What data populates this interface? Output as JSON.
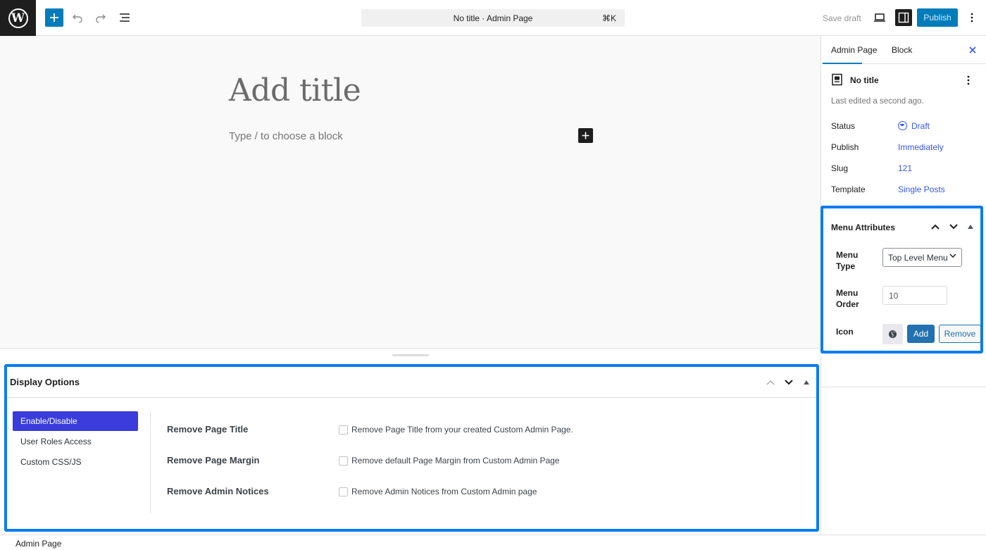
{
  "topbar": {
    "logo_letter": "W",
    "command_title": "No title · Admin Page",
    "command_shortcut": "⌘K",
    "save_draft": "Save draft",
    "publish": "Publish"
  },
  "editor": {
    "title_placeholder": "Add title",
    "block_placeholder": "Type / to choose a block"
  },
  "display_options": {
    "title": "Display Options",
    "tabs": [
      {
        "label": "Enable/Disable",
        "active": true
      },
      {
        "label": "User Roles Access",
        "active": false
      },
      {
        "label": "Custom CSS/JS",
        "active": false
      }
    ],
    "options": [
      {
        "label": "Remove Page Title",
        "description": "Remove Page Title from your created Custom Admin Page.",
        "checked": false
      },
      {
        "label": "Remove Page Margin",
        "description": "Remove default Page Margin from Custom Admin Page",
        "checked": false
      },
      {
        "label": "Remove Admin Notices",
        "description": "Remove Admin Notices from Custom Admin page",
        "checked": false
      }
    ]
  },
  "footer": {
    "breadcrumb": "Admin Page"
  },
  "sidebar": {
    "tabs": [
      "Admin Page",
      "Block"
    ],
    "doc_title": "No title",
    "last_edited": "Last edited a second ago.",
    "rows": [
      {
        "label": "Status",
        "value": "Draft"
      },
      {
        "label": "Publish",
        "value": "Immediately"
      },
      {
        "label": "Slug",
        "value": "121"
      },
      {
        "label": "Template",
        "value": "Single Posts"
      }
    ]
  },
  "menu_attributes": {
    "title": "Menu Attributes",
    "menu_type_label": "Menu Type",
    "menu_type_value": "Top Level Menu",
    "menu_order_label": "Menu Order",
    "menu_order_value": "10",
    "icon_label": "Icon",
    "add": "Add",
    "remove": "Remove"
  },
  "colors": {
    "accent": "#007cba",
    "highlight_border": "#0a7cf0",
    "active_tab": "#3a3cdc",
    "link": "#3858e9"
  }
}
